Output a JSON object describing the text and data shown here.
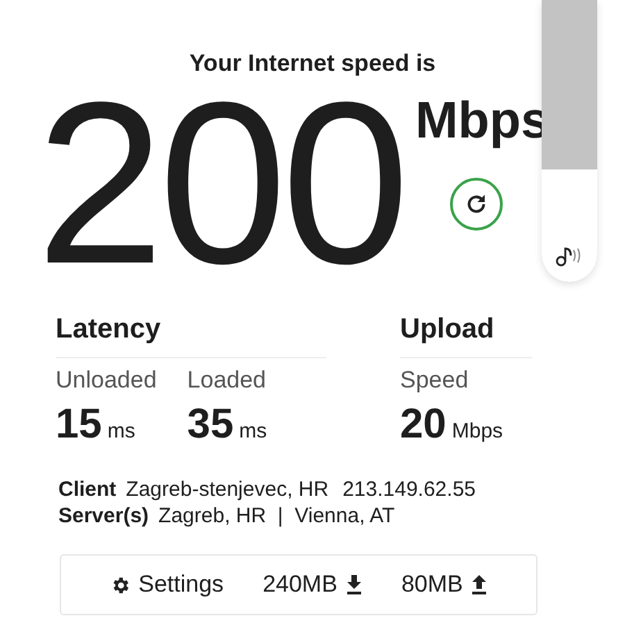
{
  "headline": "Your Internet speed is",
  "speed": {
    "value": "200",
    "unit": "Mbps"
  },
  "sections": [
    {
      "title": "Latency",
      "metrics": [
        {
          "label": "Unloaded",
          "value": "15",
          "unit": "ms"
        },
        {
          "label": "Loaded",
          "value": "35",
          "unit": "ms"
        }
      ]
    },
    {
      "title": "Upload",
      "metrics": [
        {
          "label": "Speed",
          "value": "20",
          "unit": "Mbps"
        }
      ]
    }
  ],
  "info": [
    {
      "label": "Client",
      "parts": [
        "Zagreb-stenjevec, HR",
        "213.149.62.55"
      ]
    },
    {
      "label": "Server(s)",
      "parts": [
        "Zagreb, HR  |  Vienna, AT"
      ]
    }
  ],
  "footer": {
    "settings": "Settings",
    "download": "240MB",
    "upload": "80MB"
  },
  "volume": {
    "level": 0.4
  }
}
